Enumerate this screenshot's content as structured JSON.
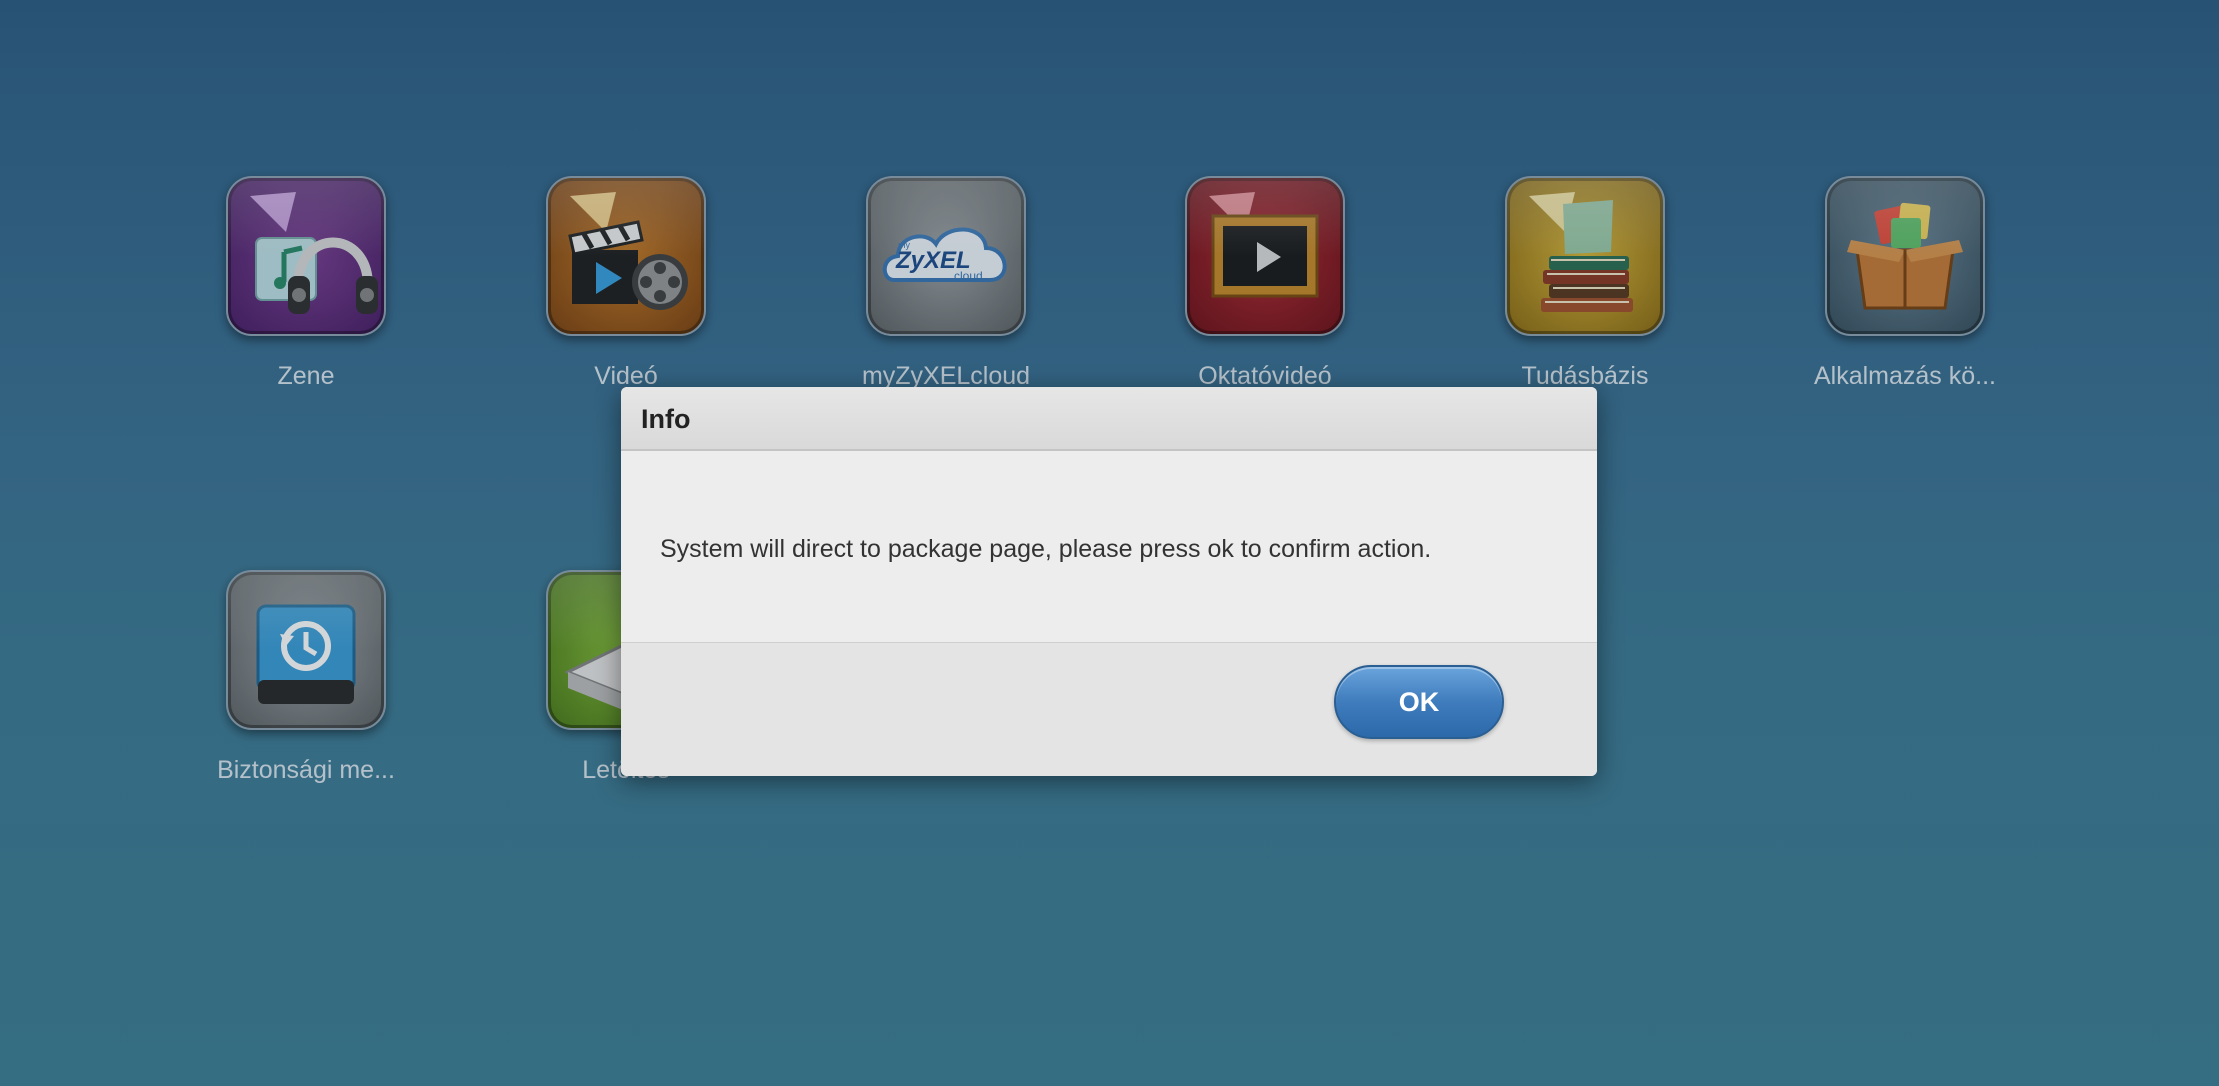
{
  "apps_row1": [
    {
      "label": "Zene",
      "icon": "music-headphones-icon"
    },
    {
      "label": "Videó",
      "icon": "video-clapper-icon"
    },
    {
      "label": "myZyXELcloud",
      "icon": "zyxel-cloud-icon"
    },
    {
      "label": "Oktatóvideó",
      "icon": "tutorial-video-icon"
    },
    {
      "label": "Tudásbázis",
      "icon": "knowledge-base-books-icon"
    },
    {
      "label": "Alkalmazás kö...",
      "icon": "app-package-box-icon"
    }
  ],
  "apps_row2": [
    {
      "label": "Biztonsági me...",
      "icon": "backup-drive-icon"
    },
    {
      "label": "Letöltés",
      "icon": "download-service-icon"
    }
  ],
  "zyxel_logo": {
    "top": "my",
    "main": "ZyXEL",
    "sub": "cloud"
  },
  "dialog": {
    "title": "Info",
    "message": "System will direct to package page, please press ok to confirm action.",
    "ok_label": "OK"
  },
  "colors": {
    "background": "#3a6f93",
    "button_accent": "#3f7cbd"
  }
}
